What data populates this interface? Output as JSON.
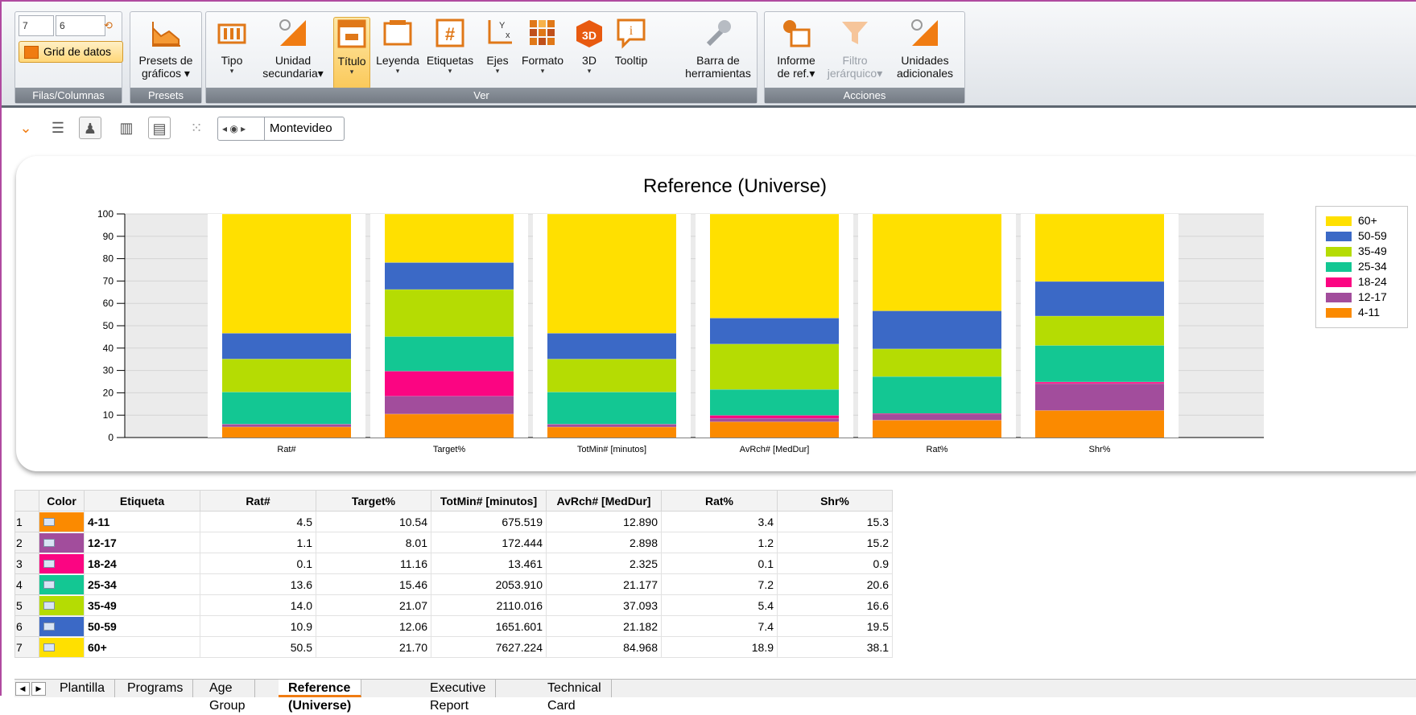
{
  "ribbon": {
    "rows_value": "7",
    "cols_value": "6",
    "grid_label": "Grid de datos",
    "groups": {
      "filas_columnas": "Filas/Columnas",
      "presets": "Presets",
      "ver": "Ver",
      "acciones": "Acciones"
    },
    "buttons": {
      "presets": [
        "Presets de",
        "gráficos"
      ],
      "tipo": "Tipo",
      "unidad": [
        "Unidad",
        "secundaria"
      ],
      "titulo": "Título",
      "leyenda": "Leyenda",
      "etiquetas": "Etiquetas",
      "ejes": "Ejes",
      "formato": "Formato",
      "tresd": "3D",
      "tooltip": "Tooltip",
      "barra": [
        "Barra de",
        "herramientas"
      ],
      "informe": [
        "Informe",
        "de ref."
      ],
      "filtro": [
        "Filtro",
        "jerárquico"
      ],
      "unidades": [
        "Unidades",
        "adicionales"
      ]
    }
  },
  "toolbar2": {
    "location": "Montevideo"
  },
  "chart_data": {
    "type": "bar",
    "stacked": true,
    "normalized_percent": true,
    "title": "Reference (Universe)",
    "categories": [
      "Rat#",
      "Target%",
      "TotMin# [minutos]",
      "AvRch# [MedDur]",
      "Rat%",
      "Shr%"
    ],
    "ylim": [
      0,
      100
    ],
    "yticks": [
      "0",
      "10",
      "20",
      "30",
      "40",
      "50",
      "60",
      "70",
      "80",
      "90",
      "100"
    ],
    "grid": true,
    "legend_position": "right",
    "series": [
      {
        "name": "4-11",
        "color": "#fb8a00",
        "values": [
          4.5,
          10.54,
          675.519,
          12.89,
          3.4,
          15.3
        ]
      },
      {
        "name": "12-17",
        "color": "#a24d9c",
        "values": [
          1.1,
          8.01,
          172.444,
          2.898,
          1.2,
          15.2
        ]
      },
      {
        "name": "18-24",
        "color": "#fb0582",
        "values": [
          0.1,
          11.16,
          13.461,
          2.325,
          0.1,
          0.9
        ]
      },
      {
        "name": "25-34",
        "color": "#13c793",
        "values": [
          13.6,
          15.46,
          2053.91,
          21.177,
          7.2,
          20.6
        ]
      },
      {
        "name": "35-49",
        "color": "#b5dc03",
        "values": [
          14.0,
          21.07,
          2110.016,
          37.093,
          5.4,
          16.6
        ]
      },
      {
        "name": "50-59",
        "color": "#3b69c6",
        "values": [
          10.9,
          12.06,
          1651.601,
          21.182,
          7.4,
          19.5
        ]
      },
      {
        "name": "60+",
        "color": "#ffe000",
        "values": [
          50.5,
          21.7,
          7627.224,
          84.968,
          18.9,
          38.1
        ]
      }
    ]
  },
  "table": {
    "headers": [
      "Color",
      "Etiqueta",
      "Rat#",
      "Target%",
      "TotMin# [minutos]",
      "AvRch# [MedDur]",
      "Rat%",
      "Shr%"
    ],
    "rows": [
      {
        "idx": "1",
        "label": "4-11",
        "vals": [
          "4.5",
          "10.54",
          "675.519",
          "12.890",
          "3.4",
          "15.3"
        ]
      },
      {
        "idx": "2",
        "label": "12-17",
        "vals": [
          "1.1",
          "8.01",
          "172.444",
          "2.898",
          "1.2",
          "15.2"
        ]
      },
      {
        "idx": "3",
        "label": "18-24",
        "vals": [
          "0.1",
          "11.16",
          "13.461",
          "2.325",
          "0.1",
          "0.9"
        ]
      },
      {
        "idx": "4",
        "label": "25-34",
        "vals": [
          "13.6",
          "15.46",
          "2053.910",
          "21.177",
          "7.2",
          "20.6"
        ]
      },
      {
        "idx": "5",
        "label": "35-49",
        "vals": [
          "14.0",
          "21.07",
          "2110.016",
          "37.093",
          "5.4",
          "16.6"
        ]
      },
      {
        "idx": "6",
        "label": "50-59",
        "vals": [
          "10.9",
          "12.06",
          "1651.601",
          "21.182",
          "7.4",
          "19.5"
        ]
      },
      {
        "idx": "7",
        "label": "60+",
        "vals": [
          "50.5",
          "21.70",
          "7627.224",
          "84.968",
          "18.9",
          "38.1"
        ]
      }
    ]
  },
  "tabs": [
    "Plantilla",
    "Programs",
    "Age Group",
    "Reference (Universe)",
    "Executive Report",
    "Technical Card"
  ],
  "active_tab": "Reference (Universe)"
}
